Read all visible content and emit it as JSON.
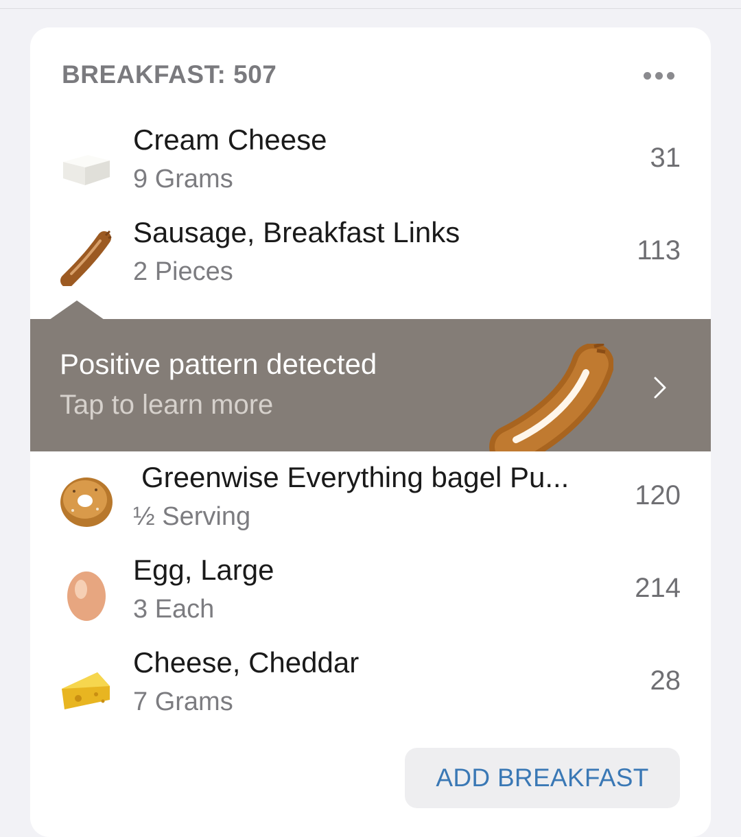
{
  "meal": {
    "title": "BREAKFAST: 507",
    "more_icon": "more-horizontal-icon",
    "items": [
      {
        "name": "Cream Cheese",
        "quantity": "9 Grams",
        "calories": "31",
        "icon": "cream-cheese-icon"
      },
      {
        "name": "Sausage, Breakfast Links",
        "quantity": "2 Pieces",
        "calories": "113",
        "icon": "sausage-icon"
      },
      {
        "name": "Greenwise Everything bagel Pu...",
        "quantity": "½ Serving",
        "calories": "120",
        "icon": "bagel-icon"
      },
      {
        "name": "Egg, Large",
        "quantity": "3 Each",
        "calories": "214",
        "icon": "egg-icon"
      },
      {
        "name": "Cheese, Cheddar",
        "quantity": "7 Grams",
        "calories": "28",
        "icon": "cheese-icon"
      }
    ]
  },
  "pattern_banner": {
    "title": "Positive pattern detected",
    "subtitle": "Tap to learn more",
    "art_icon": "sausage-icon",
    "chevron_icon": "chevron-right-icon",
    "background": "#847d77"
  },
  "add_button": {
    "label": "ADD BREAKFAST"
  },
  "colors": {
    "accent": "#3a78b5",
    "muted_text": "#7c7c80",
    "card": "#ffffff",
    "page": "#f2f2f6"
  }
}
